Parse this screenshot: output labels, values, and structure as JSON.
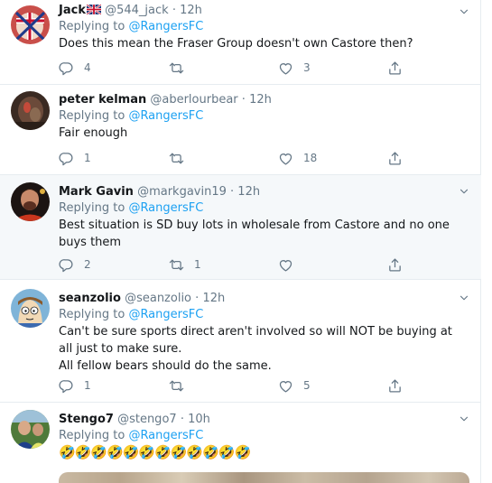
{
  "reply_prefix": "Replying to",
  "tweets": [
    {
      "name": "Jack",
      "handle": "@544_jack",
      "separator": "·",
      "time": "12h",
      "mention": "@RangersFC",
      "text": "Does this mean the Fraser Group doesn't own Castore then?",
      "replies": "4",
      "retweets": "",
      "likes": "3"
    },
    {
      "name": "peter kelman",
      "handle": "@aberlourbear",
      "separator": "·",
      "time": "12h",
      "mention": "@RangersFC",
      "text": "Fair enough",
      "replies": "1",
      "retweets": "",
      "likes": "18"
    },
    {
      "name": "Mark Gavin",
      "handle": "@markgavin19",
      "separator": "·",
      "time": "12h",
      "mention": "@RangersFC",
      "text": "Best situation is SD buy lots in wholesale from Castore and no one buys them",
      "replies": "2",
      "retweets": "1",
      "likes": ""
    },
    {
      "name": "seanzolio",
      "handle": "@seanzolio",
      "separator": "·",
      "time": "12h",
      "mention": "@RangersFC",
      "text_line1": "Can't be sure sports direct aren't involved so will NOT be buying at all just to make sure.",
      "text_line2": "All fellow bears should do the same.",
      "replies": "1",
      "retweets": "",
      "likes": "5"
    },
    {
      "name": "Stengo7",
      "handle": "@stengo7",
      "separator": "·",
      "time": "10h",
      "mention": "@RangersFC",
      "text": "🤣🤣🤣🤣🤣🤣🤣🤣🤣🤣🤣🤣"
    }
  ],
  "icons": {
    "reply": "reply-icon",
    "retweet": "retweet-icon",
    "like": "heart-icon",
    "share": "share-icon",
    "menu": "chevron-down-icon"
  },
  "colors": {
    "link": "#1da1f2",
    "muted": "#657786",
    "divider": "#e6ecf0",
    "highlight_bg": "#f5f8fa"
  }
}
